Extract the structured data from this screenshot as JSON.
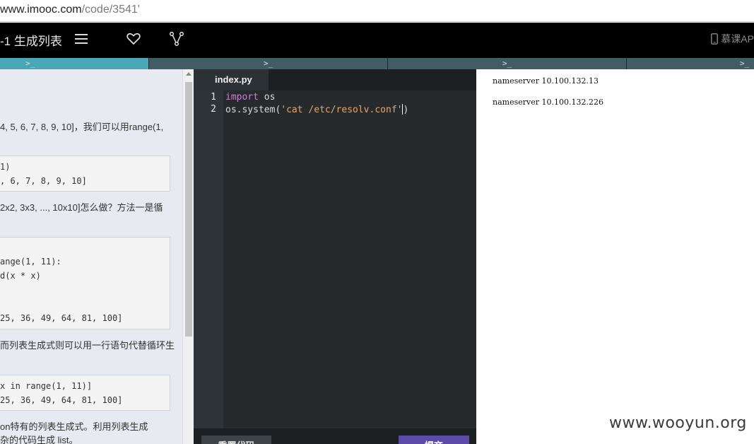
{
  "browser": {
    "url_host": "www.imooc.com",
    "url_path": "/code/3541'"
  },
  "topbar": {
    "title": "-1 生成列表",
    "menu_icon": "menu-icon",
    "favorite_icon": "heart-icon",
    "share_icon": "share-nodes-icon",
    "app_label": "慕课AP"
  },
  "tabs": [
    {
      "prompt": ">_"
    },
    {
      "prompt": ">_"
    },
    {
      "prompt": ">_"
    },
    {
      "prompt": ">_"
    }
  ],
  "lesson": {
    "p1": "4, 5, 6, 7, 8, 9, 10]，我们可以用range(1,",
    "code1": [
      "1)",
      ", 6, 7, 8, 9, 10]"
    ],
    "p2": "2x2, 3x3, ..., 10x10]怎么做？方法一是循",
    "code2": [
      "ange(1, 11):",
      "d(x * x)",
      "",
      "",
      "25, 36, 49, 64, 81, 100]"
    ],
    "p3": "而列表生成式则可以用一行语句代替循环生",
    "code3": [
      " x in range(1, 11)]",
      "25, 36, 49, 64, 81, 100]"
    ],
    "p4": "on特有的列表生成式。利用列表生成",
    "p5": "杂的代码生成 list。"
  },
  "editor": {
    "filename": "index.py",
    "lines": [
      {
        "no": "1",
        "kw": "import",
        "rest": " os",
        "str": "",
        "tail": ""
      },
      {
        "no": "2",
        "kw": "",
        "rest": "os.system(",
        "str": "'cat /etc/resolv.conf'",
        "tail": ")"
      }
    ],
    "reset_label": "重置代码",
    "submit_label": "提交"
  },
  "output": {
    "lines": [
      "nameserver 10.100.132.13",
      "nameserver 10.100.132.226"
    ]
  },
  "watermark": "www.wooyun.org"
}
